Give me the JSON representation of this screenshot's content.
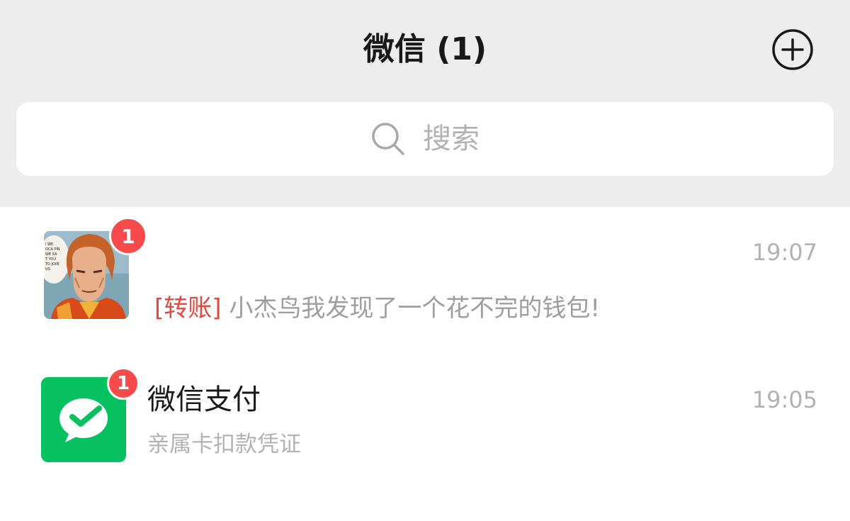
{
  "header": {
    "title": "微信 (1)"
  },
  "search": {
    "placeholder": "搜索"
  },
  "chats": [
    {
      "name": "",
      "time": "19:07",
      "badge": "1",
      "tag": "[转账]",
      "preview": "小杰鸟我发现了一个花不完的钱包!",
      "avatar": "comic-character-avatar",
      "avatar_speech": "I WE\nOCA PIN\nWE SA\nT YOU\nTO JOIN\nUS."
    },
    {
      "name": "微信支付",
      "time": "19:05",
      "badge": "1",
      "preview": "亲属卡扣款凭证",
      "avatar": "wechat-pay-icon"
    }
  ],
  "colors": {
    "top_bg": "#ededed",
    "badge_red": "#f74b4b",
    "tag_red": "#e0483e",
    "wechat_green": "#07c160"
  }
}
